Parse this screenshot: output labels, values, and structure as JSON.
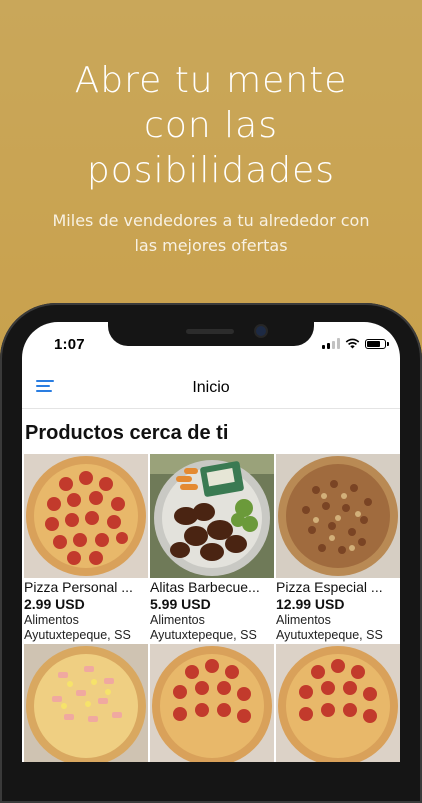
{
  "promo": {
    "headline_lines": [
      "Abre tu mente",
      "con las",
      "posibilidades"
    ],
    "subtitle_lines": [
      "Miles de vendedores a tu alrededor con",
      "las mejores ofertas"
    ]
  },
  "status_bar": {
    "time": "1:07"
  },
  "app_bar": {
    "title": "Inicio",
    "menu_icon": "hamburger-menu-icon"
  },
  "section": {
    "title": "Productos cerca de ti"
  },
  "products": [
    {
      "name": "Pizza Personal ...",
      "price": "2.99 USD",
      "category": "Alimentos",
      "location": "Ayutuxtepeque, SS",
      "image": "pepperoni-pizza"
    },
    {
      "name": "Alitas Barbecue...",
      "price": "5.99 USD",
      "category": "Alimentos",
      "location": "Ayutuxtepeque, SS",
      "image": "bbq-wings-plate"
    },
    {
      "name": "Pizza Especial ...",
      "price": "12.99 USD",
      "category": "Alimentos",
      "location": "Ayutuxtepeque, SS",
      "image": "special-pizza"
    },
    {
      "image": "hawaiian-pizza"
    },
    {
      "image": "pepperoni-pizza"
    },
    {
      "image": "pepperoni-pizza"
    }
  ],
  "colors": {
    "background_gold": "#c9a352",
    "accent_blue": "#2a7de1",
    "phone_frame": "#151515"
  }
}
